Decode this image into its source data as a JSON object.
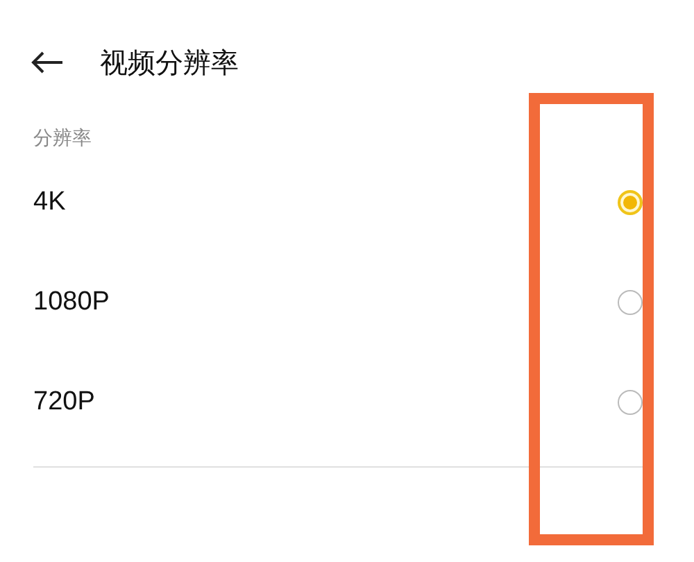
{
  "header": {
    "title": "视频分辨率"
  },
  "section": {
    "label": "分辨率"
  },
  "options": [
    {
      "label": "4K",
      "selected": true
    },
    {
      "label": "1080P",
      "selected": false
    },
    {
      "label": "720P",
      "selected": false
    }
  ]
}
